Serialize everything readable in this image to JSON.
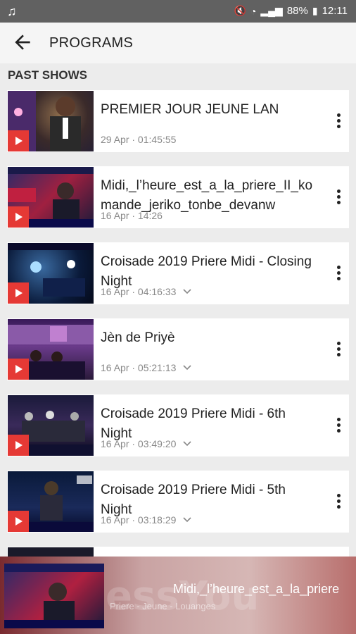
{
  "statusbar": {
    "battery": "88%",
    "time": "12:11"
  },
  "appbar": {
    "title": "PROGRAMS"
  },
  "section_title": "PAST SHOWS",
  "items": [
    {
      "title": "PREMIER JOUR JEUNE LAN",
      "meta": "29 Apr · 01:45:55"
    },
    {
      "title": "Midi,_l’heure_est_a_la_priere_II_komande_jeriko_tonbe_devanw",
      "meta": "16 Apr · 14:26"
    },
    {
      "title": "Croisade 2019 Priere Midi - Closing Night",
      "meta": "16 Apr · 04:16:33"
    },
    {
      "title": "Jèn de Priyè",
      "meta": "16 Apr · 05:21:13"
    },
    {
      "title": "Croisade 2019 Priere Midi - 6th Night",
      "meta": "16 Apr · 03:49:20"
    },
    {
      "title": "Croisade 2019 Priere Midi - 5th Night",
      "meta": "16 Apr · 03:18:29"
    }
  ],
  "miniplayer": {
    "title": "Midi,_l’heure_est_a_la_priere",
    "subtitle": "Priere - Jeune - Louanges"
  }
}
